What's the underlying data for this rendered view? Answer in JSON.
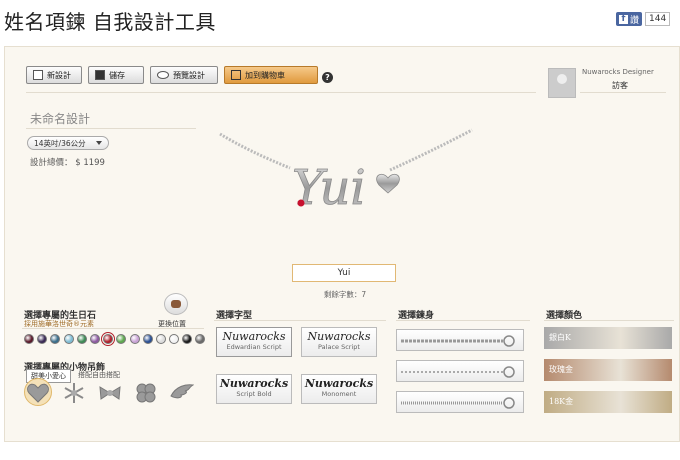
{
  "page_title": "姓名項鍊 自我設計工具",
  "facebook": {
    "like_label": "讚",
    "count": "144"
  },
  "toolbar": {
    "new_label": "新設計",
    "save_label": "儲存",
    "preview_label": "預覽設計",
    "cart_label": "加到購物車",
    "help_label": "?"
  },
  "designer": {
    "name": "Nuwarocks Designer",
    "role": "訪客"
  },
  "design": {
    "name": "未命名設計",
    "size_selected": "14英吋/36公分",
    "total_label": "設計總價：",
    "total_value": "$ 1199",
    "pendant_text": "Yui"
  },
  "name_input": {
    "value": "Yui"
  },
  "remaining": "剩餘字數：7",
  "birthstone": {
    "title": "選擇專屬的生日石",
    "subtitle": "採用施華洛世奇®元素",
    "position_label": "更換位置",
    "stones": [
      "#5a1a2a",
      "#3a2a55",
      "#3a6d8a",
      "#7fbcd3",
      "#3e8a55",
      "#8c5aa0",
      "#b0202a",
      "#5ea84f",
      "#c9a3d6",
      "#2a4f92",
      "#dcdcdc",
      "#f2f2f2",
      "#1a1a1a",
      "#6a6a6a"
    ]
  },
  "charm": {
    "title": "選擇專屬的小物吊飾",
    "tooltip": "甜美小愛心",
    "subtitle_suffix": "搭配自由搭配",
    "icons": [
      "heart-charm-icon",
      "snowflake-charm-icon",
      "bow-charm-icon",
      "clover-charm-icon",
      "wing-charm-icon"
    ]
  },
  "font": {
    "title": "選擇字型",
    "options": [
      {
        "sample": "Nuwarocks",
        "label": "Edwardian Script"
      },
      {
        "sample": "Nuwarocks",
        "label": "Palace Script"
      },
      {
        "sample": "Nuwarocks",
        "label": "Script Bold"
      },
      {
        "sample": "Nuwarocks",
        "label": "Monoment"
      }
    ]
  },
  "chain": {
    "title": "選擇鍊身"
  },
  "color": {
    "title": "選擇顏色",
    "options": [
      {
        "label": "銀白K",
        "color": "#a9a9a9"
      },
      {
        "label": "玫瑰金",
        "color": "#b58a6e"
      },
      {
        "label": "18K金",
        "color": "#c0ac84"
      }
    ]
  }
}
